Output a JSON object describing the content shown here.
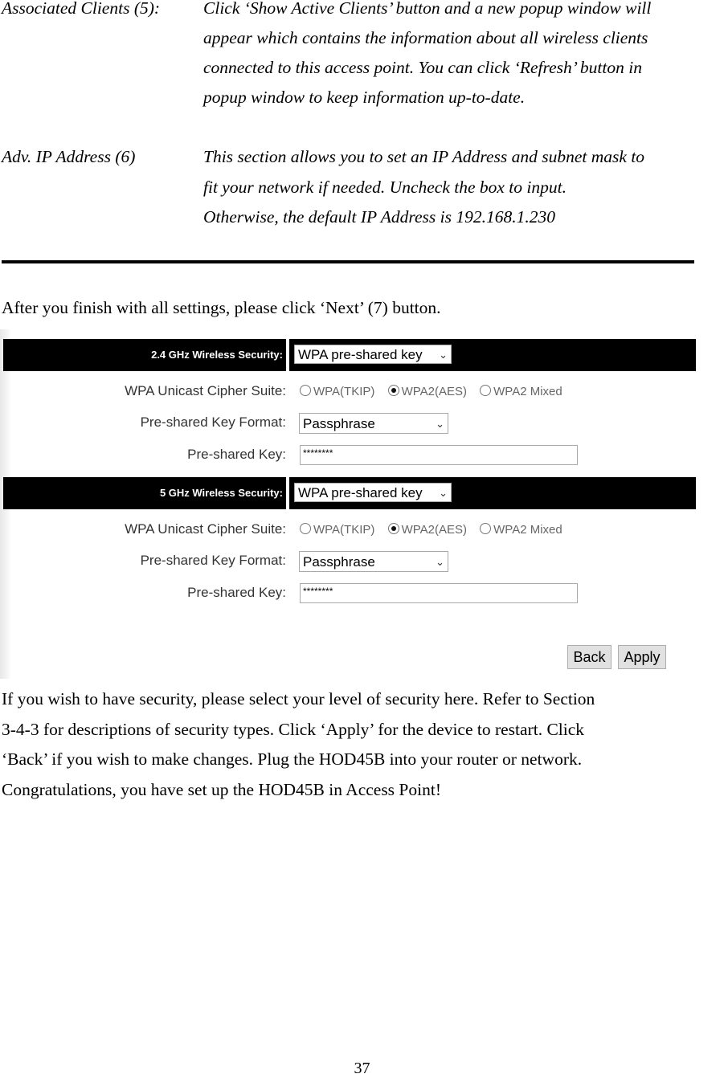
{
  "definitions": [
    {
      "term": "Associated Clients (5):",
      "lines": [
        "Click ‘Show Active Clients’ button and a new popup window will",
        "appear which contains the information about all wireless clients",
        "connected to this access point. You can click ‘Refresh’ button in",
        "popup window to keep information up-to-date."
      ]
    },
    {
      "term": "Adv. IP Address (6)",
      "lines": [
        "This section allows you to set an IP Address and subnet mask to",
        "fit your network if needed.    Uncheck the box to input.",
        "Otherwise, the default IP Address is 192.168.1.230"
      ]
    }
  ],
  "intro": "After you finish with all settings, please click ‘Next’ (7) button.",
  "screenshot": {
    "sections": [
      {
        "band_label": "2.4 GHz Wireless Security:",
        "security_mode": "WPA pre-shared key",
        "cipher_label": "WPA Unicast Cipher Suite:",
        "cipher_options": [
          "WPA(TKIP)",
          "WPA2(AES)",
          "WPA2 Mixed"
        ],
        "cipher_selected": "WPA2(AES)",
        "key_format_label": "Pre-shared Key Format:",
        "key_format": "Passphrase",
        "key_label": "Pre-shared Key:",
        "key_value": "********"
      },
      {
        "band_label": "5 GHz Wireless Security:",
        "security_mode": "WPA pre-shared key",
        "cipher_label": "WPA Unicast Cipher Suite:",
        "cipher_options": [
          "WPA(TKIP)",
          "WPA2(AES)",
          "WPA2 Mixed"
        ],
        "cipher_selected": "WPA2(AES)",
        "key_format_label": "Pre-shared Key Format:",
        "key_format": "Passphrase",
        "key_label": "Pre-shared Key:",
        "key_value": "********"
      }
    ],
    "buttons": {
      "back": "Back",
      "apply": "Apply"
    }
  },
  "closing_lines": [
    "If you wish to have security, please select your level of security here. Refer to Section",
    "3-4-3 for descriptions of security types.    Click ‘Apply’ for the device to restart.    Click",
    "‘Back’ if you wish to make changes.    Plug the HOD45B into your router or network.",
    "Congratulations, you have set up the HOD45B in Access Point!"
  ],
  "page_number": "37"
}
